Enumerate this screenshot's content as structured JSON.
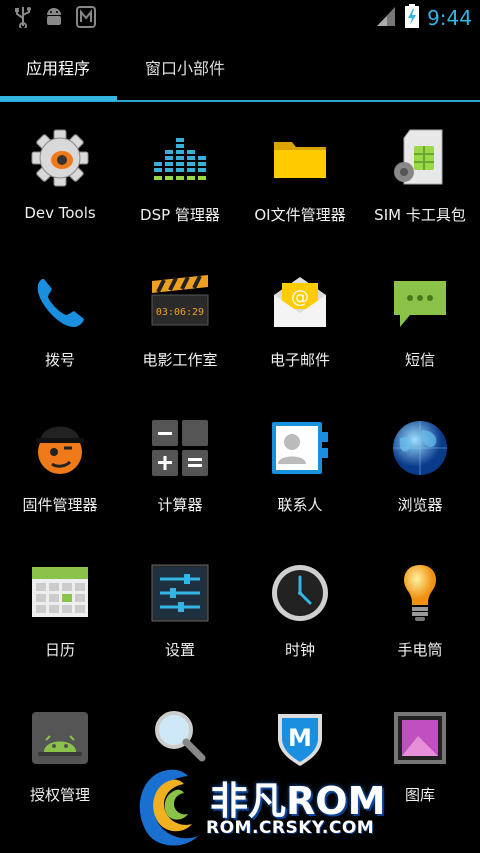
{
  "status_bar": {
    "time": "9:44",
    "time_color": "#33b5e5",
    "left_icons": [
      "usb-icon",
      "android-debug-icon",
      "m-app-icon"
    ],
    "right_icons": [
      "signal-icon",
      "battery-charging-icon"
    ]
  },
  "tabs": {
    "apps_label": "应用程序",
    "widgets_label": "窗口小部件",
    "accent_color": "#33b5e5"
  },
  "apps": [
    {
      "label": "Dev Tools",
      "icon": "gear-icon"
    },
    {
      "label": "DSP 管理器",
      "icon": "equalizer-icon"
    },
    {
      "label": "OI文件管理器",
      "icon": "folder-icon"
    },
    {
      "label": "SIM 卡工具包",
      "icon": "sim-card-icon"
    },
    {
      "label": "拨号",
      "icon": "phone-icon"
    },
    {
      "label": "电影工作室",
      "icon": "clapperboard-icon"
    },
    {
      "label": "电子邮件",
      "icon": "email-icon"
    },
    {
      "label": "短信",
      "icon": "message-icon"
    },
    {
      "label": "固件管理器",
      "icon": "rom-manager-icon"
    },
    {
      "label": "计算器",
      "icon": "calculator-icon"
    },
    {
      "label": "联系人",
      "icon": "contacts-icon"
    },
    {
      "label": "浏览器",
      "icon": "globe-icon"
    },
    {
      "label": "日历",
      "icon": "calendar-icon"
    },
    {
      "label": "设置",
      "icon": "settings-sliders-icon"
    },
    {
      "label": "时钟",
      "icon": "clock-icon"
    },
    {
      "label": "手电筒",
      "icon": "lightbulb-icon"
    },
    {
      "label": "授权管理",
      "icon": "superuser-icon"
    },
    {
      "label": "",
      "icon": "magnifier-icon"
    },
    {
      "label": "",
      "icon": "m-shield-icon"
    },
    {
      "label": "图库",
      "icon": "gallery-icon"
    }
  ],
  "watermark": {
    "brand": "非凡ROM",
    "url": "ROM.CRSKY.COM"
  }
}
